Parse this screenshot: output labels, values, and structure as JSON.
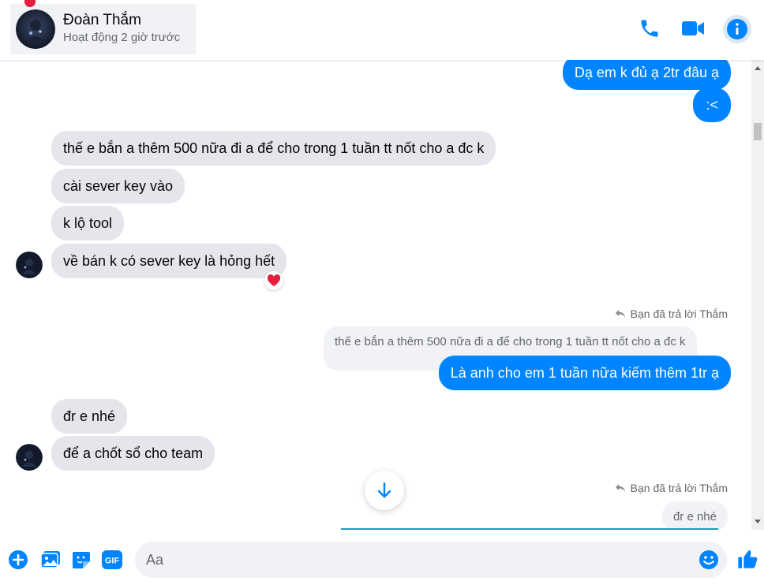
{
  "header": {
    "contact_name": "Đoàn Thắm",
    "contact_status": "Hoạt động 2 giờ trước"
  },
  "messages": [
    {
      "text": "Dạ em k đủ ạ 2tr đâu ạ"
    },
    {
      "text": ":<"
    },
    {
      "text": "thế e bắn a thêm 500 nữa đi a để cho trong 1 tuần tt nốt cho a đc k"
    },
    {
      "text": "cài sever key vào"
    },
    {
      "text": "k lộ tool"
    },
    {
      "text": "về bán k có sever key là hỏng hết"
    },
    {
      "text": "Là anh cho em 1 tuần nữa kiếm thêm 1tr ạ"
    },
    {
      "text": "đr e nhé"
    },
    {
      "text": "để a chốt sổ cho team"
    }
  ],
  "replies": [
    {
      "note": "Bạn đã trả lời Thắm",
      "quote": "thế e bắn a thêm 500 nữa đi a để cho trong 1 tuần tt nốt cho a đc k"
    },
    {
      "note": "Bạn đã trả lời Thắm",
      "quote": "đr e nhé"
    }
  ],
  "composer": {
    "placeholder": "Aa"
  },
  "colors": {
    "accent": "#0084ff",
    "incoming_bubble": "#e4e6eb",
    "reaction_heart": "#e41e3f"
  },
  "icons": [
    "phone-icon",
    "video-icon",
    "info-icon",
    "plus-icon",
    "image-icon",
    "sticker-icon",
    "gif-icon",
    "emoji-icon",
    "like-icon",
    "reply-arrow-icon",
    "arrow-down-icon",
    "heart-icon"
  ]
}
